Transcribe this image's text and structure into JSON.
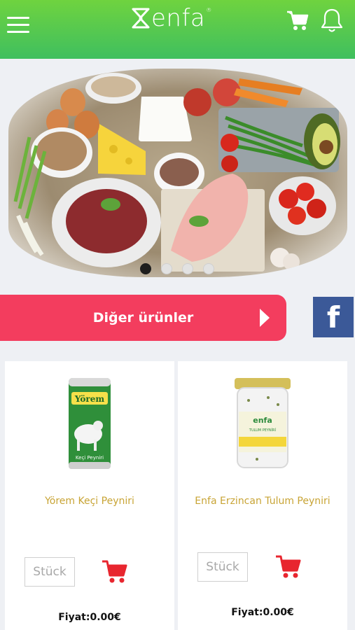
{
  "header": {
    "logo_text": "enfa",
    "logo_mark": "®",
    "menu_icon": "hamburger-menu-icon",
    "cart_icon": "shopping-cart-icon",
    "bell_icon": "notification-bell-icon"
  },
  "banner": {
    "image": "fresh-groceries-photo",
    "slides": 4,
    "active_slide": 1
  },
  "actions": {
    "other_products_label": "Diğer ürünler",
    "facebook_label": "f"
  },
  "products": [
    {
      "name": "Yörem Keçi Peyniri",
      "image": "yorem-goat-cheese-can",
      "qty_placeholder": "Stück",
      "price": "Fiyat:0.00€"
    },
    {
      "name": "Enfa Erzincan Tulum Peyniri",
      "image": "enfa-tulum-cheese-jar",
      "qty_placeholder": "Stück",
      "price": "Fiyat:0.00€"
    }
  ],
  "colors": {
    "header_green": "#4cc44f",
    "accent_red": "#f33d5e",
    "cart_red": "#e8262f",
    "facebook_blue": "#3b5998",
    "product_name_gold": "#c8a435"
  }
}
